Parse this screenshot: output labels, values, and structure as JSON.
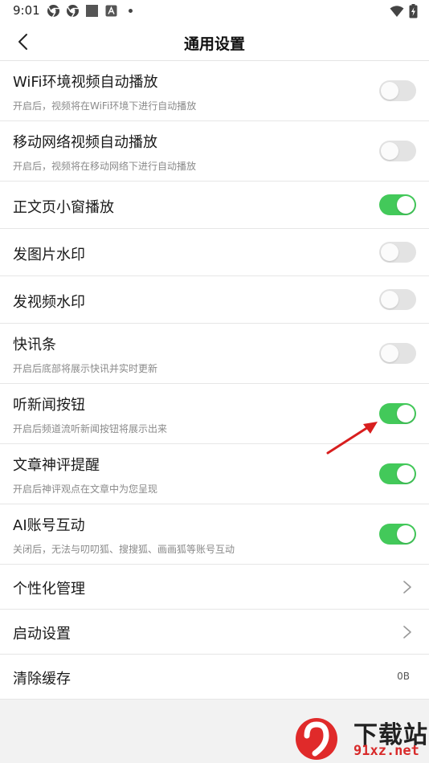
{
  "status_bar": {
    "time": "9:01",
    "left_icons": [
      "chrome-icon",
      "chrome-icon",
      "square-icon",
      "a-box-icon",
      "dot-icon"
    ],
    "right_icons": [
      "wifi-icon",
      "battery-charging-icon"
    ]
  },
  "header": {
    "title": "通用设置",
    "back_icon": "chevron-left-icon"
  },
  "settings": [
    {
      "title": "WiFi环境视频自动播放",
      "subtitle": "开启后，视频将在WiFi环境下进行自动播放",
      "type": "toggle",
      "on": false
    },
    {
      "title": "移动网络视频自动播放",
      "subtitle": "开启后，视频将在移动网络下进行自动播放",
      "type": "toggle",
      "on": false
    },
    {
      "title": "正文页小窗播放",
      "subtitle": "",
      "type": "toggle",
      "on": true
    },
    {
      "title": "发图片水印",
      "subtitle": "",
      "type": "toggle",
      "on": false
    },
    {
      "title": "发视频水印",
      "subtitle": "",
      "type": "toggle",
      "on": false
    },
    {
      "title": "快讯条",
      "subtitle": "开启后底部将展示快讯并实时更新",
      "type": "toggle",
      "on": false
    },
    {
      "title": "听新闻按钮",
      "subtitle": "开启后频道流听新闻按钮将展示出来",
      "type": "toggle",
      "on": true
    },
    {
      "title": "文章神评提醒",
      "subtitle": "开启后神评观点在文章中为您呈现",
      "type": "toggle",
      "on": true
    },
    {
      "title": "AI账号互动",
      "subtitle": "关闭后，无法与叨叨狐、搜搜狐、画画狐等账号互动",
      "type": "toggle",
      "on": true
    },
    {
      "title": "个性化管理",
      "type": "nav"
    },
    {
      "title": "启动设置",
      "type": "nav"
    },
    {
      "title": "清除缓存",
      "type": "value",
      "value": "0B"
    }
  ],
  "colors": {
    "toggle_on": "#43c95a",
    "toggle_off": "#e3e3e3",
    "annotation_arrow": "#d81e1e"
  },
  "watermark": {
    "brand": "下载站",
    "domain": "91xz.net"
  }
}
